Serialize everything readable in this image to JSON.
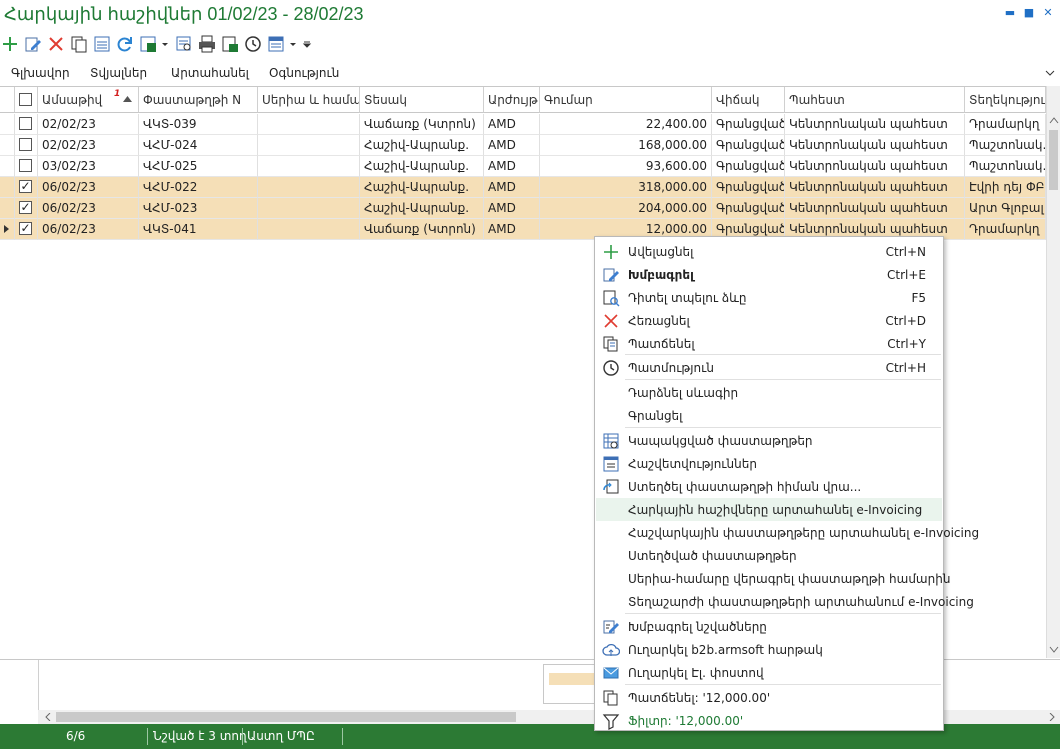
{
  "window": {
    "title": "Հարկային հաշիվներ 01/02/23 - 28/02/23",
    "minimize": "▬",
    "maximize": "■",
    "close": "✕"
  },
  "menu": [
    "Գլխավոր",
    "Տվյալներ",
    "Արտահանել",
    "Օգնություն"
  ],
  "columns": [
    "Ամսաթիվ",
    "Փաստաթղթի N",
    "Սերիա և համար",
    "Տեսակ",
    "Արժույթ",
    "Գումար",
    "Վիճակ",
    "Պահեստ",
    "Տեղեկություն"
  ],
  "sort_order_marker": "1",
  "rows": [
    {
      "checked": false,
      "date": "02/02/23",
      "docno": "ՎԿՏ-039",
      "series": "",
      "type": "Վաճառք (Կտրոն)",
      "currency": "AMD",
      "amount": "22,400.00",
      "state": "Գրանցված",
      "warehouse": "Կենտրոնական պահեստ",
      "info": "Դրամարկղ"
    },
    {
      "checked": false,
      "date": "02/02/23",
      "docno": "ՎՀՄ-024",
      "series": "",
      "type": "Հաշիվ-Ապրանք.",
      "currency": "AMD",
      "amount": "168,000.00",
      "state": "Գրանցված",
      "warehouse": "Կենտրոնական պահեստ",
      "info": "Պաշտոնակ..."
    },
    {
      "checked": false,
      "date": "03/02/23",
      "docno": "ՎՀՄ-025",
      "series": "",
      "type": "Հաշիվ-Ապրանք.",
      "currency": "AMD",
      "amount": "93,600.00",
      "state": "Գրանցված",
      "warehouse": "Կենտրոնական պահեստ",
      "info": "Պաշտոնակ..."
    },
    {
      "checked": true,
      "date": "06/02/23",
      "docno": "ՎՀՄ-022",
      "series": "",
      "type": "Հաշիվ-Ապրանք.",
      "currency": "AMD",
      "amount": "318,000.00",
      "state": "Գրանցված",
      "warehouse": "Կենտրոնական պահեստ",
      "info": "Էվրի դեյ ՓԲԸ"
    },
    {
      "checked": true,
      "date": "06/02/23",
      "docno": "ՎՀՄ-023",
      "series": "",
      "type": "Հաշիվ-Ապրանք.",
      "currency": "AMD",
      "amount": "204,000.00",
      "state": "Գրանցված",
      "warehouse": "Կենտրոնական պահեստ",
      "info": "Արտ Գլոբալ..."
    },
    {
      "checked": true,
      "date": "06/02/23",
      "docno": "ՎԿՏ-041",
      "series": "",
      "type": "Վաճառք (Կտրոն)",
      "currency": "AMD",
      "amount": "12,000.00",
      "state": "Գրանցված",
      "warehouse": "Կենտրոնական պահեստ",
      "info": "Դրամարկղ"
    }
  ],
  "context_menu": [
    {
      "label": "Ավելացնել",
      "shortcut": "Ctrl+N",
      "icon": "plus-icon"
    },
    {
      "label": "Խմբագրել",
      "shortcut": "Ctrl+E",
      "icon": "edit-icon"
    },
    {
      "label": "Դիտել տպելու ձևը",
      "shortcut": "F5",
      "icon": "print-preview-icon"
    },
    {
      "label": "Հեռացնել",
      "shortcut": "Ctrl+D",
      "icon": "delete-icon"
    },
    {
      "label": "Պատճենել",
      "shortcut": "Ctrl+Y",
      "icon": "copy-icon"
    },
    {
      "label": "Պատմություն",
      "shortcut": "Ctrl+H",
      "icon": "history-icon"
    },
    {
      "label": "Դարձնել սևագիր",
      "shortcut": "",
      "icon": ""
    },
    {
      "label": "Գրանցել",
      "shortcut": "",
      "icon": ""
    },
    {
      "label": "Կապակցված փաստաթղթեր",
      "shortcut": "",
      "icon": "linked-docs-icon"
    },
    {
      "label": "Հաշվետվություններ",
      "shortcut": "",
      "icon": "report-icon"
    },
    {
      "label": "Ստեղծել փաստաթղթի հիման վրա...",
      "shortcut": "",
      "icon": "create-based-icon"
    },
    {
      "label": "Հարկային հաշիվները արտահանել e-Invoicing",
      "shortcut": "",
      "icon": ""
    },
    {
      "label": "Հաշվարկային փաստաթղթերը արտահանել e-Invoicing",
      "shortcut": "",
      "icon": ""
    },
    {
      "label": "Ստեղծված փաստաթղթեր",
      "shortcut": "",
      "icon": ""
    },
    {
      "label": "Սերիա-համարը վերագրել փաստաթղթի համարին",
      "shortcut": "",
      "icon": ""
    },
    {
      "label": "Տեղաշարժի փաստաթղթերի արտահանում e-Invoicing",
      "shortcut": "",
      "icon": ""
    },
    {
      "label": "Խմբագրել նշվածները",
      "shortcut": "",
      "icon": "edit-selected-icon"
    },
    {
      "label": "Ուղարկել b2b.armsoft հարթակ",
      "shortcut": "",
      "icon": "cloud-upload-icon"
    },
    {
      "label": "Ուղարկել Էլ. փոստով",
      "shortcut": "",
      "icon": "email-icon"
    },
    {
      "label": "Պատճենել: '12,000.00'",
      "shortcut": "",
      "icon": "copy-value-icon"
    },
    {
      "label": "Ֆիլտր: '12,000.00'",
      "shortcut": "",
      "icon": "filter-icon"
    }
  ],
  "status": {
    "count": "6/6",
    "marked": "Նշված է 3 տող",
    "user": "Աստղ ՄՊԸ"
  },
  "colors": {
    "accent": "#2c7a34",
    "selected_row": "#f5dfb7",
    "title": "#1e7a34"
  }
}
